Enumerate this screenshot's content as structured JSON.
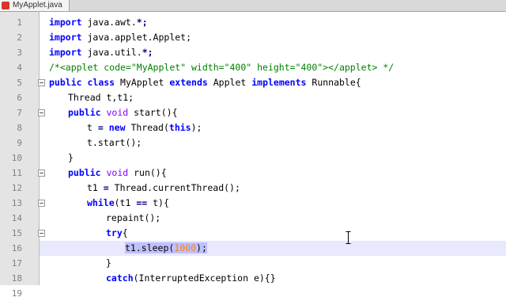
{
  "tab": {
    "filename": "MyApplet.java"
  },
  "lines": [
    {
      "n": "1",
      "indent": 0,
      "fold": false,
      "tokens": [
        {
          "t": "import",
          "c": "kw"
        },
        {
          "t": " java.awt."
        },
        {
          "t": "*;",
          "c": "op"
        }
      ]
    },
    {
      "n": "2",
      "indent": 0,
      "fold": false,
      "tokens": [
        {
          "t": "import",
          "c": "kw"
        },
        {
          "t": " java.applet.Applet;"
        }
      ]
    },
    {
      "n": "3",
      "indent": 0,
      "fold": false,
      "tokens": [
        {
          "t": "import",
          "c": "kw"
        },
        {
          "t": " java.util."
        },
        {
          "t": "*;",
          "c": "op"
        }
      ]
    },
    {
      "n": "4",
      "indent": 0,
      "fold": false,
      "tokens": [
        {
          "t": "/*<applet code=\"MyApplet\" width=\"400\" height=\"400\"></applet> */",
          "c": "cm"
        }
      ]
    },
    {
      "n": "5",
      "indent": 0,
      "fold": true,
      "tokens": [
        {
          "t": "public",
          "c": "kw"
        },
        {
          "t": " "
        },
        {
          "t": "class",
          "c": "kw"
        },
        {
          "t": " MyApplet "
        },
        {
          "t": "extends",
          "c": "kw"
        },
        {
          "t": " Applet "
        },
        {
          "t": "implements",
          "c": "kw"
        },
        {
          "t": " Runnable{"
        }
      ]
    },
    {
      "n": "6",
      "indent": 1,
      "fold": false,
      "tokens": [
        {
          "t": "Thread t,t1;"
        }
      ]
    },
    {
      "n": "7",
      "indent": 1,
      "fold": true,
      "tokens": [
        {
          "t": "public",
          "c": "kw"
        },
        {
          "t": " "
        },
        {
          "t": "void",
          "c": "typ"
        },
        {
          "t": " start(){"
        }
      ]
    },
    {
      "n": "8",
      "indent": 2,
      "fold": false,
      "tokens": [
        {
          "t": "t "
        },
        {
          "t": "=",
          "c": "op"
        },
        {
          "t": " "
        },
        {
          "t": "new",
          "c": "kw"
        },
        {
          "t": " Thread("
        },
        {
          "t": "this",
          "c": "kw"
        },
        {
          "t": ");"
        }
      ]
    },
    {
      "n": "9",
      "indent": 2,
      "fold": false,
      "tokens": [
        {
          "t": "t.start();"
        }
      ]
    },
    {
      "n": "10",
      "indent": 1,
      "fold": false,
      "tokens": [
        {
          "t": "}"
        }
      ]
    },
    {
      "n": "11",
      "indent": 1,
      "fold": true,
      "tokens": [
        {
          "t": "public",
          "c": "kw"
        },
        {
          "t": " "
        },
        {
          "t": "void",
          "c": "typ"
        },
        {
          "t": " run(){"
        }
      ]
    },
    {
      "n": "12",
      "indent": 2,
      "fold": false,
      "tokens": [
        {
          "t": "t1 "
        },
        {
          "t": "=",
          "c": "op"
        },
        {
          "t": " Thread.currentThread();"
        }
      ]
    },
    {
      "n": "13",
      "indent": 2,
      "fold": true,
      "tokens": [
        {
          "t": "while",
          "c": "kw"
        },
        {
          "t": "(t1 "
        },
        {
          "t": "==",
          "c": "op"
        },
        {
          "t": " t){"
        }
      ]
    },
    {
      "n": "14",
      "indent": 3,
      "fold": false,
      "tokens": [
        {
          "t": "repaint();"
        }
      ]
    },
    {
      "n": "15",
      "indent": 3,
      "fold": true,
      "tokens": [
        {
          "t": "try",
          "c": "kw"
        },
        {
          "t": "{"
        }
      ]
    },
    {
      "n": "16",
      "indent": 4,
      "fold": false,
      "current": true,
      "tokens": [
        {
          "t": "t1.sleep(",
          "c": "hl"
        },
        {
          "t": "1000",
          "c": "num hl"
        },
        {
          "t": ");",
          "c": "hl"
        }
      ]
    },
    {
      "n": "17",
      "indent": 3,
      "fold": false,
      "tokens": [
        {
          "t": "}"
        }
      ]
    },
    {
      "n": "18",
      "indent": 3,
      "fold": false,
      "tokens": [
        {
          "t": "catch",
          "c": "kw"
        },
        {
          "t": "(InterruptedException e){}"
        }
      ]
    },
    {
      "n": "19",
      "indent": 2,
      "fold": false,
      "tokens": [
        {
          "t": "}"
        }
      ]
    }
  ]
}
